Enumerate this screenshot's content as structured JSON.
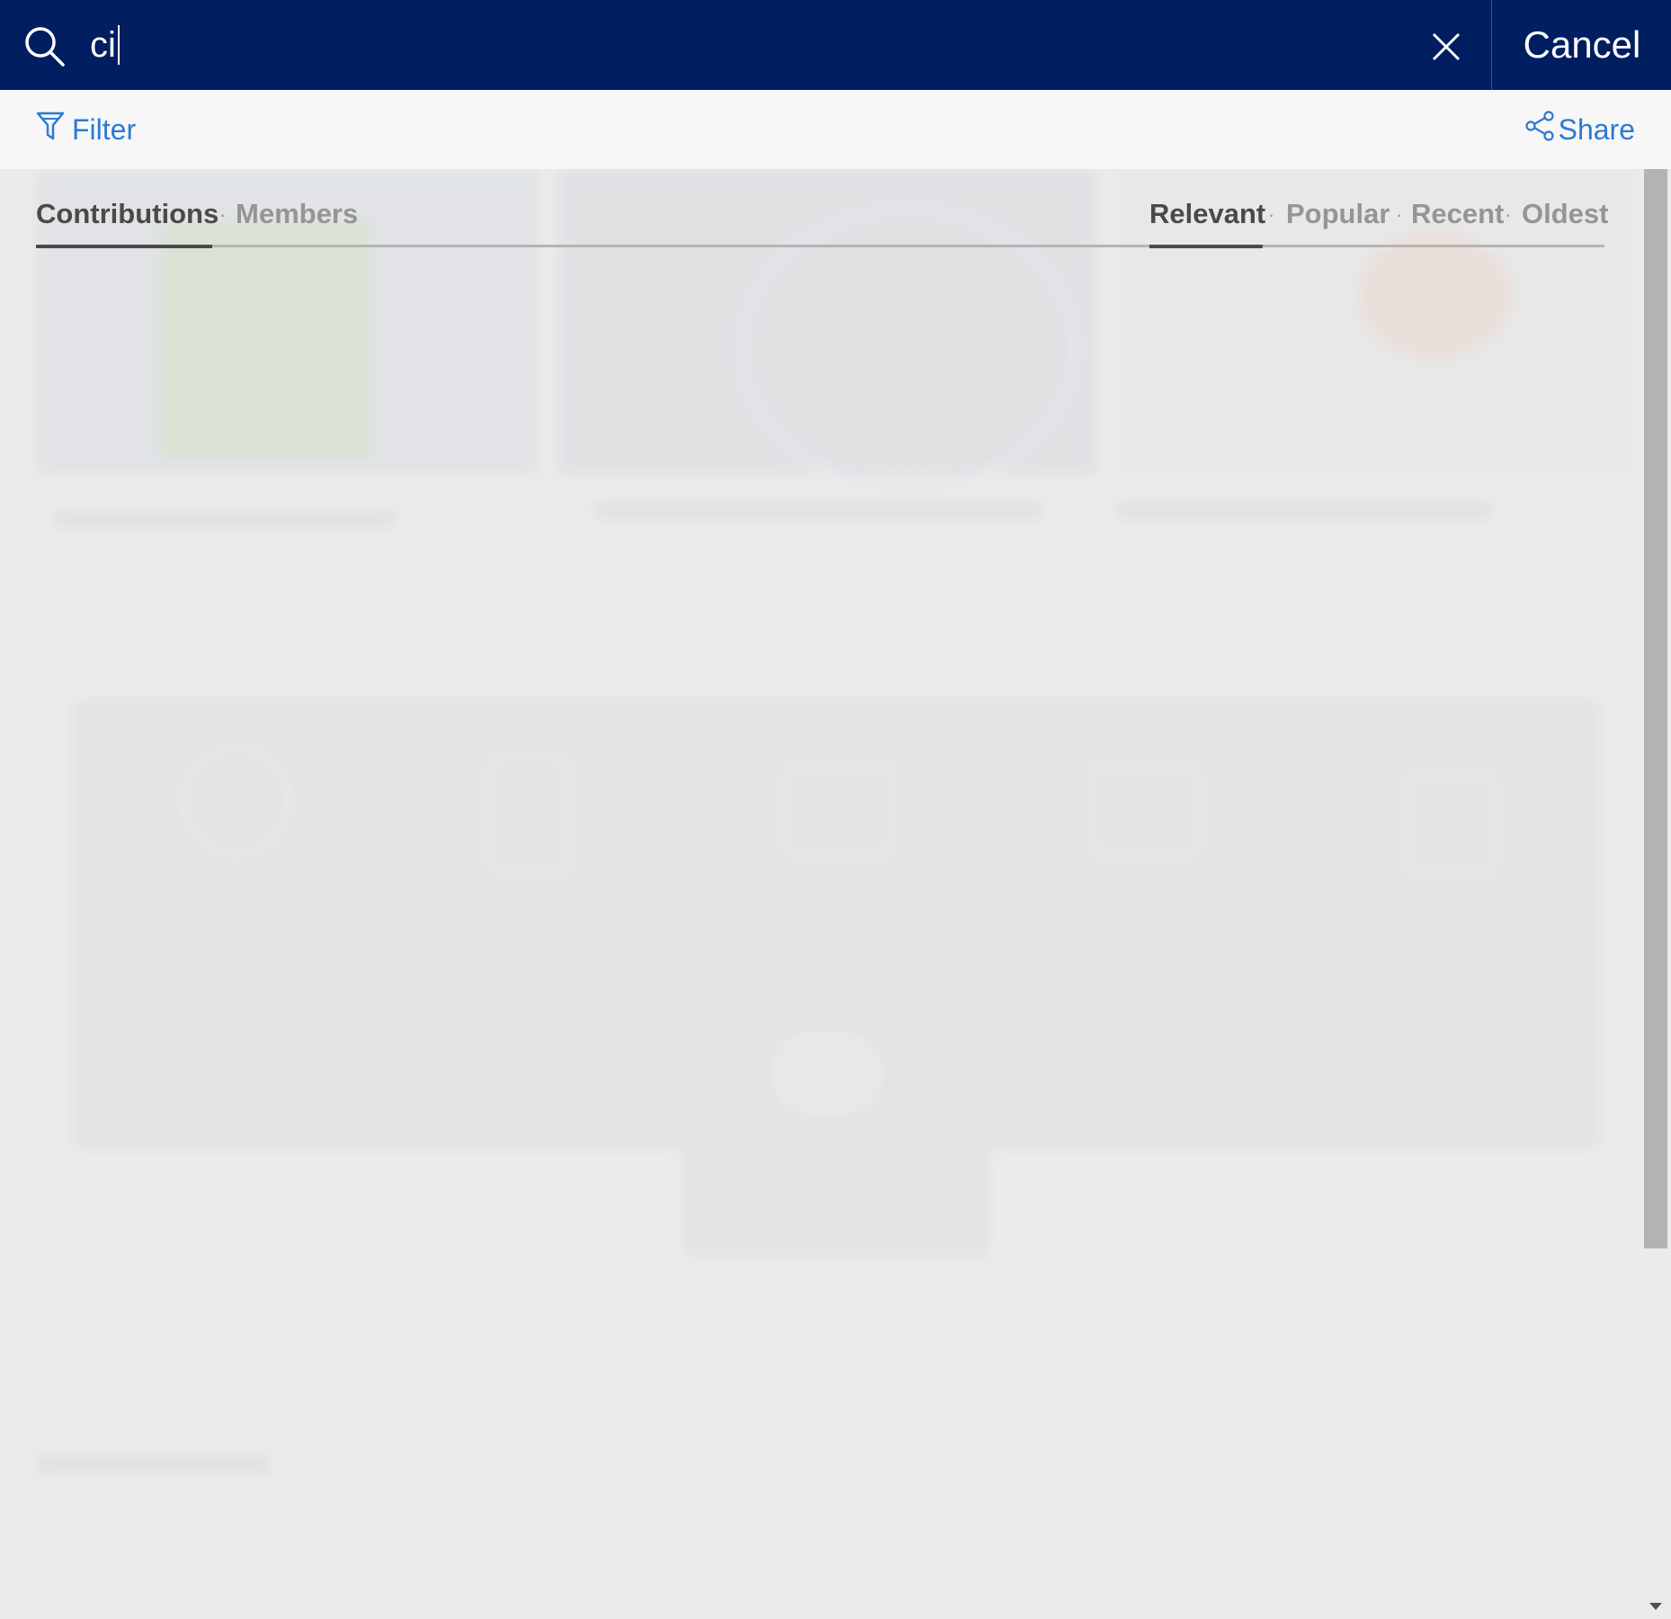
{
  "search": {
    "query": "ci",
    "cancel_label": "Cancel"
  },
  "actions": {
    "filter_label": "Filter",
    "share_label": "Share"
  },
  "tabs": {
    "contributions": "Contributions",
    "members": "Members",
    "separator": "·"
  },
  "sort": {
    "relevant": "Relevant",
    "popular": "Popular",
    "recent": "Recent",
    "oldest": "Oldest"
  },
  "colors": {
    "header_bg": "#001e60",
    "link_blue": "#2b7bd1",
    "active_text": "#4a4a4a",
    "inactive_text": "#959595"
  },
  "icons": {
    "search": "search-icon",
    "clear": "close-icon",
    "filter": "filter-icon",
    "share": "share-icon"
  }
}
